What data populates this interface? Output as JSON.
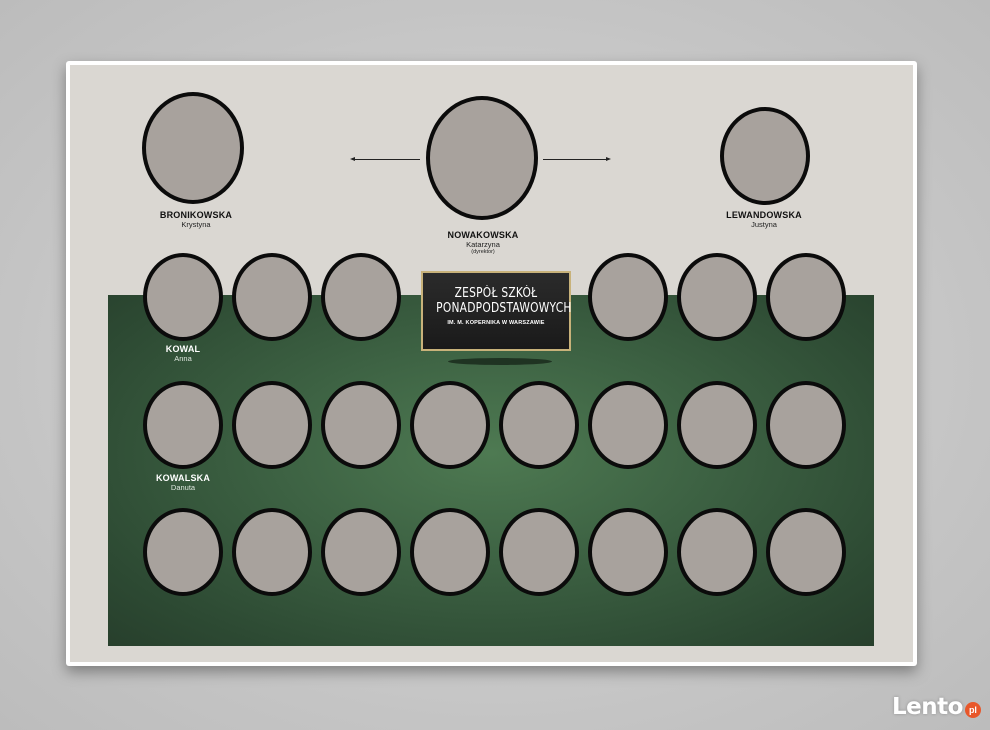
{
  "school": {
    "line1": "ZESPÓŁ SZKÓŁ",
    "line2": "PONADPODSTAWOWYCH",
    "line3": "IM. M. KOPERNIKA W WARSZAWIE"
  },
  "staff": {
    "left": {
      "surname": "BRONIKOWSKA",
      "firstname": "Krystyna"
    },
    "center": {
      "surname": "NOWAKOWSKA",
      "firstname": "Katarzyna",
      "role": "(dyrektor)"
    },
    "right": {
      "surname": "LEWANDOWSKA",
      "firstname": "Justyna"
    }
  },
  "students": {
    "row1_first": {
      "surname": "KOWAL",
      "firstname": "Anna"
    },
    "row2_first": {
      "surname": "KOWALSKA",
      "firstname": "Danuta"
    }
  },
  "watermark": {
    "text": "Lento",
    "badge": "pl"
  }
}
